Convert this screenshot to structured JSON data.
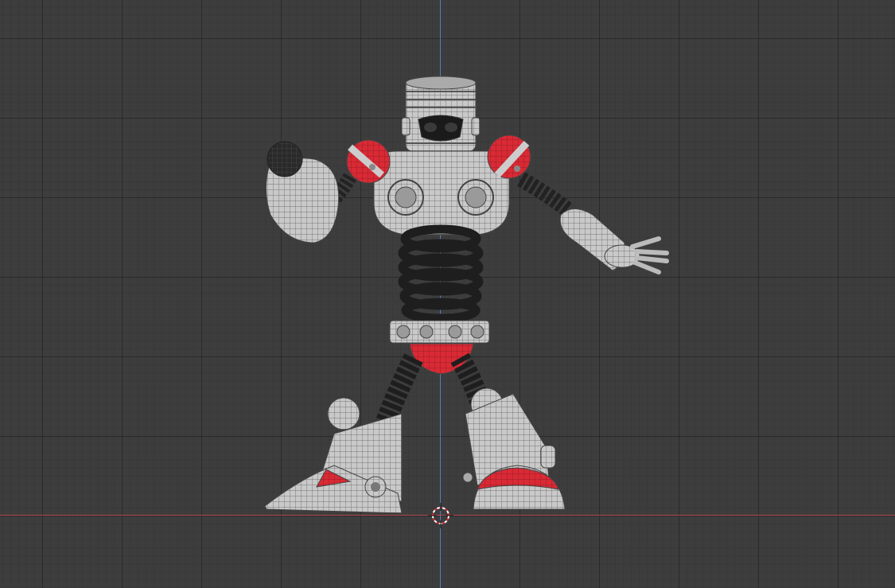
{
  "viewport": {
    "view": "front-orthographic",
    "background_color": "#3d3d3d",
    "axis_colors": {
      "x": "#b54a55",
      "z": "#4f7fc4"
    },
    "object": {
      "display": "wireframe-on-solid",
      "colors": {
        "base": "#c9c9c9",
        "accent": "#d92a35",
        "spring": "#1e1e1e"
      }
    }
  },
  "icons": {
    "cursor": "3d-cursor-icon"
  }
}
